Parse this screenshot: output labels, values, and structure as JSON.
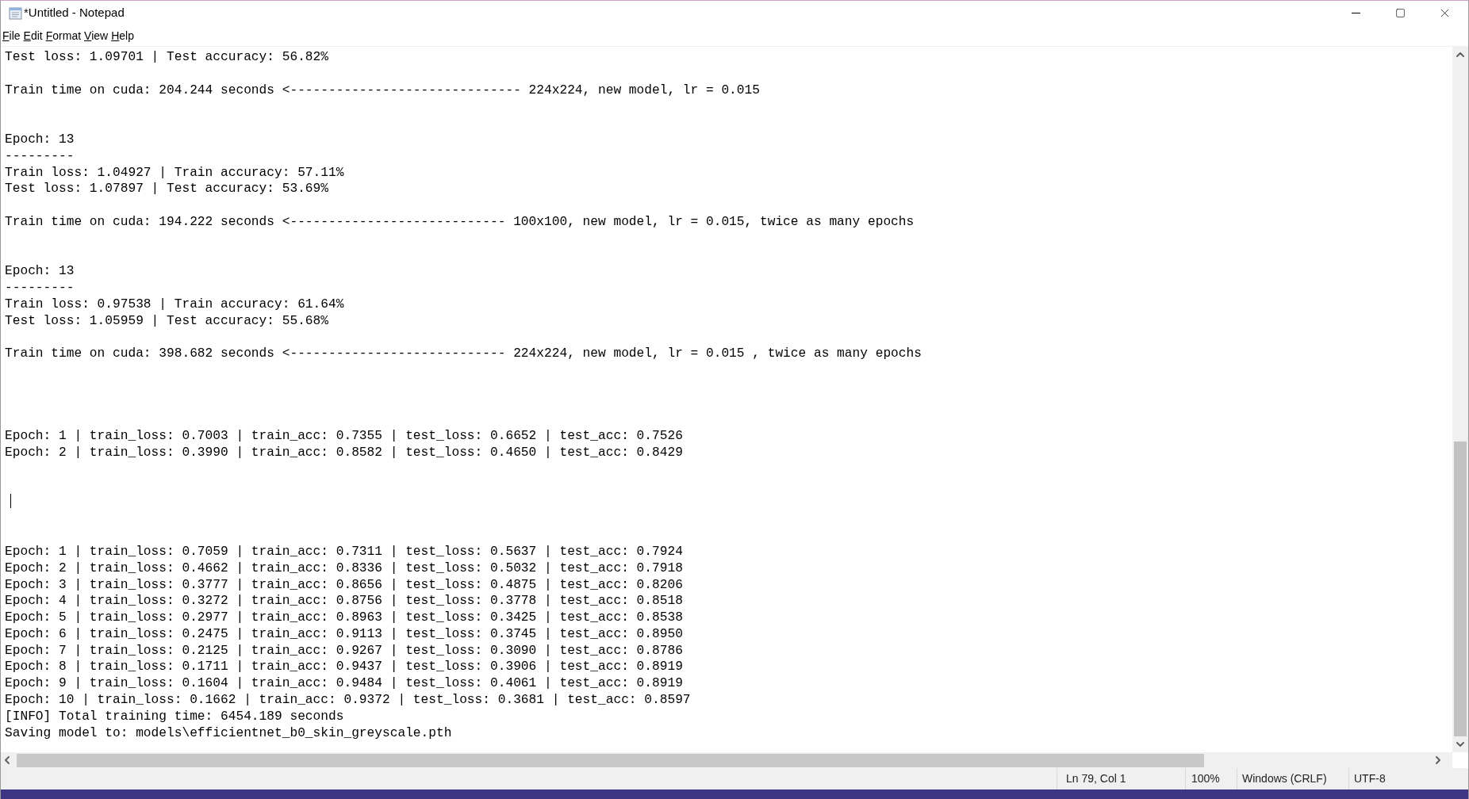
{
  "window": {
    "title": "*Untitled - Notepad"
  },
  "menu": [
    "File",
    "Edit",
    "Format",
    "View",
    "Help"
  ],
  "lines": [
    {
      "kind": "text",
      "text": "Test loss: 1.09701 | Test accuracy: 56.82%"
    },
    {
      "kind": "blank"
    },
    {
      "kind": "text",
      "text": "Train time on cuda: 204.244 seconds <------------------------------ 224x224, new model, lr = 0.015"
    },
    {
      "kind": "blank"
    },
    {
      "kind": "blank"
    },
    {
      "kind": "text",
      "text": "Epoch: 13"
    },
    {
      "kind": "text",
      "text": "---------"
    },
    {
      "kind": "text",
      "text": "Train loss: 1.04927 | Train accuracy: 57.11%"
    },
    {
      "kind": "text",
      "text": "Test loss: 1.07897 | Test accuracy: 53.69%"
    },
    {
      "kind": "blank"
    },
    {
      "kind": "text",
      "text": "Train time on cuda: 194.222 seconds <---------------------------- 100x100, new model, lr = 0.015, twice as many epochs"
    },
    {
      "kind": "blank"
    },
    {
      "kind": "blank"
    },
    {
      "kind": "text",
      "text": "Epoch: 13"
    },
    {
      "kind": "text",
      "text": "---------"
    },
    {
      "kind": "text",
      "text": "Train loss: 0.97538 | Train accuracy: 61.64%"
    },
    {
      "kind": "text",
      "text": "Test loss: 1.05959 | Test accuracy: 55.68%"
    },
    {
      "kind": "blank"
    },
    {
      "kind": "text",
      "text": "Train time on cuda: 398.682 seconds <---------------------------- 224x224, new model, lr = 0.015 , twice as many epochs"
    },
    {
      "kind": "blank"
    },
    {
      "kind": "blank"
    },
    {
      "kind": "blank"
    },
    {
      "kind": "blank"
    },
    {
      "kind": "text",
      "text": "Epoch: 1 | train_loss: 0.7003 | train_acc: 0.7355 | test_loss: 0.6652 | test_acc: 0.7526"
    },
    {
      "kind": "text",
      "text": "Epoch: 2 | train_loss: 0.3990 | train_acc: 0.8582 | test_loss: 0.4650 | test_acc: 0.8429"
    },
    {
      "kind": "blank"
    },
    {
      "kind": "blank"
    },
    {
      "kind": "cursor"
    },
    {
      "kind": "blank"
    },
    {
      "kind": "blank"
    },
    {
      "kind": "text",
      "text": "Epoch: 1 | train_loss: 0.7059 | train_acc: 0.7311 | test_loss: 0.5637 | test_acc: 0.7924"
    },
    {
      "kind": "text",
      "text": "Epoch: 2 | train_loss: 0.4662 | train_acc: 0.8336 | test_loss: 0.5032 | test_acc: 0.7918"
    },
    {
      "kind": "text",
      "text": "Epoch: 3 | train_loss: 0.3777 | train_acc: 0.8656 | test_loss: 0.4875 | test_acc: 0.8206"
    },
    {
      "kind": "text",
      "text": "Epoch: 4 | train_loss: 0.3272 | train_acc: 0.8756 | test_loss: 0.3778 | test_acc: 0.8518"
    },
    {
      "kind": "text",
      "text": "Epoch: 5 | train_loss: 0.2977 | train_acc: 0.8963 | test_loss: 0.3425 | test_acc: 0.8538"
    },
    {
      "kind": "text",
      "text": "Epoch: 6 | train_loss: 0.2475 | train_acc: 0.9113 | test_loss: 0.3745 | test_acc: 0.8950"
    },
    {
      "kind": "text",
      "text": "Epoch: 7 | train_loss: 0.2125 | train_acc: 0.9267 | test_loss: 0.3090 | test_acc: 0.8786"
    },
    {
      "kind": "text",
      "text": "Epoch: 8 | train_loss: 0.1711 | train_acc: 0.9437 | test_loss: 0.3906 | test_acc: 0.8919"
    },
    {
      "kind": "text",
      "text": "Epoch: 9 | train_loss: 0.1604 | train_acc: 0.9484 | test_loss: 0.4061 | test_acc: 0.8919"
    },
    {
      "kind": "text",
      "text": "Epoch: 10 | train_loss: 0.1662 | train_acc: 0.9372 | test_loss: 0.3681 | test_acc: 0.8597"
    },
    {
      "kind": "text",
      "text": "[INFO] Total training time: 6454.189 seconds"
    },
    {
      "kind": "text",
      "text": "Saving model to: models\\efficientnet_b0_skin_greyscale.pth"
    }
  ],
  "status_bar": {
    "position": "Ln 79, Col 1",
    "zoom": "100%",
    "line_ending": "Windows (CRLF)",
    "encoding": "UTF-8"
  }
}
